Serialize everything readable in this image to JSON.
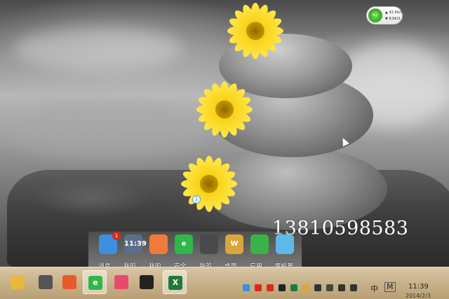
{
  "net_monitor": {
    "percent": "61",
    "up_speed": "42.9K/S",
    "down_speed": "8.6K/S"
  },
  "notification_bubble": "1",
  "watermark_phone": "13810598583",
  "dock": {
    "items": [
      {
        "label": "消息...",
        "icon": "contacts-icon",
        "color": "#3d8fe0",
        "badge": "1"
      },
      {
        "label": "我的...",
        "icon": "calendar-icon",
        "color": "#5b6e8a",
        "text": "11:39"
      },
      {
        "label": "我的...",
        "icon": "pinwheel-icon",
        "color": "#f07a3a"
      },
      {
        "label": "安全...",
        "icon": "ie-browser-icon",
        "color": "#2fb84a",
        "text": "e"
      },
      {
        "label": "我的...",
        "icon": "apps-grid-icon",
        "color": "#4a4a4a"
      },
      {
        "label": "桌面...",
        "icon": "briefcase-icon",
        "color": "#d8a63a",
        "text": "W"
      },
      {
        "label": "应用...",
        "icon": "cube-icon",
        "color": "#3ab24a"
      },
      {
        "label": "废纸篓",
        "icon": "recycle-bin-icon",
        "color": "#5fb9e8"
      }
    ]
  },
  "taskbar": {
    "buttons": [
      {
        "icon": "file-explorer-icon",
        "color": "#e8b83a",
        "active": false
      },
      {
        "icon": "media-player-icon",
        "color": "#555555",
        "active": false
      },
      {
        "icon": "face-app-icon",
        "color": "#e85a2a",
        "active": false
      },
      {
        "icon": "browser-360-icon",
        "color": "#2fb84a",
        "active": true,
        "text": "e"
      },
      {
        "icon": "gallery-icon",
        "color": "#e84a6a",
        "active": false
      },
      {
        "icon": "qq-penguin-icon",
        "color": "#222222",
        "active": false
      },
      {
        "icon": "excel-icon",
        "color": "#1e7a3a",
        "active": true,
        "text": "X"
      }
    ],
    "tray_icons": [
      "security-shield-icon",
      "qq-tray-icon",
      "qq-tray-icon-2",
      "media-tray-icon",
      "input-tray-icon",
      "game-tray-icon",
      "display-tray-icon",
      "battery-icon",
      "network-signal-icon",
      "volume-icon"
    ],
    "ime_label": "中",
    "ime_mode": "M",
    "clock_time": "11:39",
    "clock_date": "2014/2/3"
  }
}
